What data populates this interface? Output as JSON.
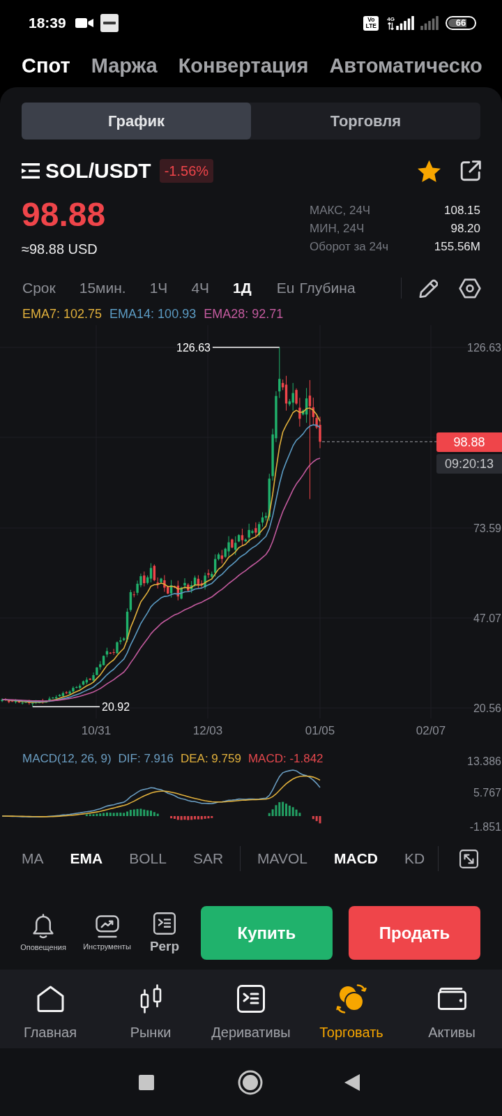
{
  "status_bar": {
    "time": "18:39",
    "volte": "Vo LTE",
    "network": "4G",
    "battery": "66"
  },
  "market_tabs": [
    {
      "label": "Спот",
      "selected": true
    },
    {
      "label": "Маржа",
      "selected": false
    },
    {
      "label": "Конвертация",
      "selected": false
    },
    {
      "label": "Автоматическо",
      "selected": false
    }
  ],
  "view_switch": [
    {
      "label": "График",
      "selected": true
    },
    {
      "label": "Торговля",
      "selected": false
    }
  ],
  "pair": {
    "symbol": "SOL/USDT",
    "change": "-1.56%",
    "price_down": true,
    "favorite": true,
    "price": "98.88",
    "price_usd": "≈98.88 USD"
  },
  "stats": [
    {
      "label": "МАКС, 24Ч",
      "value": "108.15"
    },
    {
      "label": "МИН, 24Ч",
      "value": "98.20"
    },
    {
      "label": "Оборот за 24ч",
      "value": "155.56M"
    }
  ],
  "timeframes": [
    {
      "label": "Срок",
      "selected": false
    },
    {
      "label": "15мин.",
      "selected": false
    },
    {
      "label": "1Ч",
      "selected": false
    },
    {
      "label": "4Ч",
      "selected": false
    },
    {
      "label": "1Д",
      "selected": true
    }
  ],
  "more_tab": {
    "label": "Eu",
    "selected": false
  },
  "depth_tab": {
    "label": "Глубина",
    "selected": false
  },
  "chart": {
    "legend": [
      {
        "label": "EMA7: 102.75",
        "color": "#e2b13c"
      },
      {
        "label": "EMA14: 100.93",
        "color": "#5c9cc4"
      },
      {
        "label": "EMA28: 92.71",
        "color": "#c45b9f"
      }
    ],
    "price_axis": [
      "126.63",
      "73.59",
      "47.07",
      "20.56"
    ],
    "date_axis": [
      "10/31",
      "12/03",
      "01/05",
      "02/07"
    ],
    "high_label": "126.63",
    "low_label": "20.92",
    "last_price": "98.88",
    "countdown": "09:20:13"
  },
  "macd": {
    "legend": [
      {
        "label": "MACD(12, 26, 9)",
        "color": "#6b9ec2"
      },
      {
        "label": "DIF: 7.916",
        "color": "#6b9ec2"
      },
      {
        "label": "DEA: 9.759",
        "color": "#e2b13c"
      },
      {
        "label": "MACD: -1.842",
        "color": "#e5484d"
      }
    ],
    "axis": [
      "13.386",
      "5.767",
      "-1.851"
    ]
  },
  "indicators": {
    "main": [
      {
        "label": "MA",
        "selected": false
      },
      {
        "label": "EMA",
        "selected": true
      },
      {
        "label": "BOLL",
        "selected": false
      },
      {
        "label": "SAR",
        "selected": false
      }
    ],
    "sub": [
      {
        "label": "MAVOL",
        "selected": false
      },
      {
        "label": "MACD",
        "selected": true
      },
      {
        "label": "KD",
        "selected": false
      }
    ]
  },
  "tools": [
    {
      "label": "Оповещения",
      "kind": "alerts"
    },
    {
      "label": "Инструменты",
      "kind": "tools"
    },
    {
      "label": "Perp",
      "kind": "perp"
    }
  ],
  "actions": [
    {
      "label": "Купить",
      "kind": "buy"
    },
    {
      "label": "Продать",
      "kind": "sell"
    }
  ],
  "bottom_nav": [
    {
      "label": "Главная",
      "kind": "home",
      "selected": false
    },
    {
      "label": "Рынки",
      "kind": "markets",
      "selected": false
    },
    {
      "label": "Деривативы",
      "kind": "derivatives",
      "selected": false
    },
    {
      "label": "Торговать",
      "kind": "trade",
      "selected": true
    },
    {
      "label": "Активы",
      "kind": "assets",
      "selected": false
    }
  ]
}
